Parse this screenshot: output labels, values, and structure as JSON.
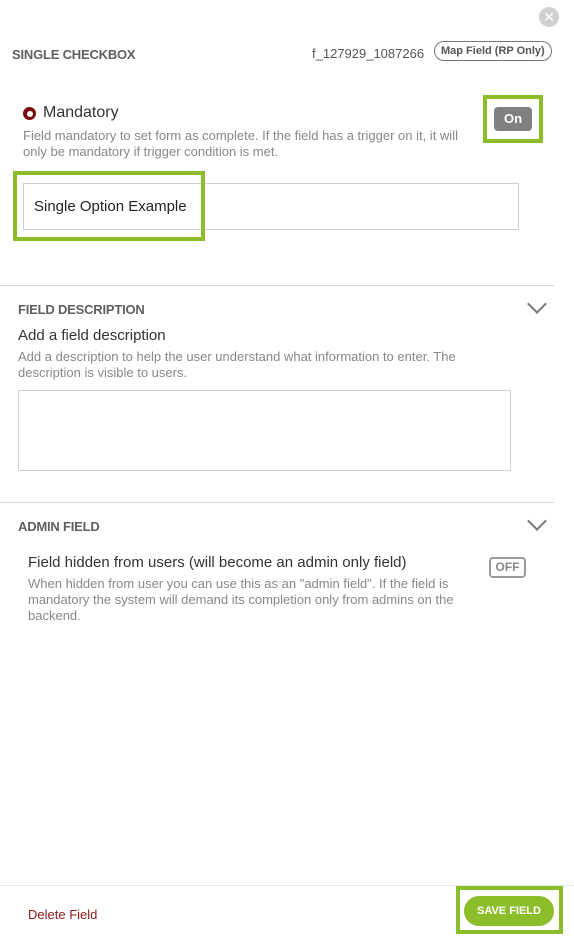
{
  "header": {
    "title": "SINGLE CHECKBOX",
    "field_id": "f_127929_1087266",
    "map_field_label": "Map Field (RP Only)",
    "close_icon": "close-icon"
  },
  "mandatory": {
    "label": "Mandatory",
    "description": "Field mandatory to set form as complete. If the field has a trigger on it, it will only be mandatory if trigger condition is met.",
    "toggle_label": "On"
  },
  "option_input": {
    "value": "Single Option Example"
  },
  "field_description": {
    "title": "FIELD DESCRIPTION",
    "subheading": "Add a field description",
    "help": "Add a description to help the user understand what information to enter. The description is visible to users.",
    "value": ""
  },
  "admin_field": {
    "title": "ADMIN FIELD",
    "label": "Field hidden from users (will become an admin only field)",
    "help": "When hidden from user you can use this as an \"admin field\". If the field is mandatory the system will demand its completion only from admins on the backend.",
    "toggle_label": "OFF"
  },
  "footer": {
    "delete_label": "Delete Field",
    "save_label": "SAVE FIELD"
  },
  "colors": {
    "accent_green": "#8cbd2a",
    "danger_red": "#8b1a1a",
    "radio_red": "#7a0d0d"
  }
}
